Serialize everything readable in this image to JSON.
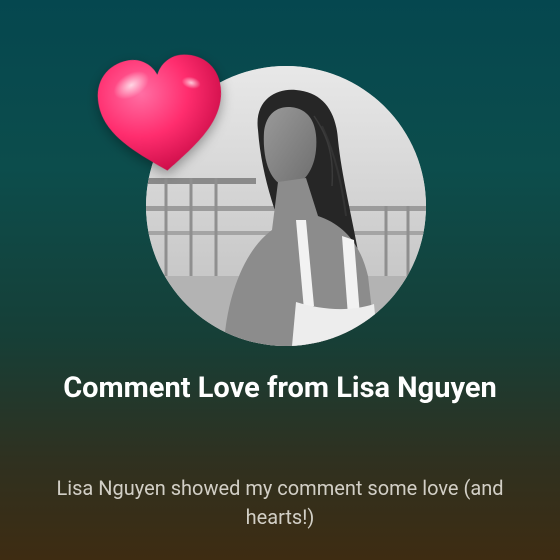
{
  "notification": {
    "title": "Comment Love from Lisa Nguyen",
    "message": "Lisa Nguyen showed my comment some love (and hearts!)",
    "icon": "heart-icon",
    "accent_color": "#ff2d6e"
  }
}
